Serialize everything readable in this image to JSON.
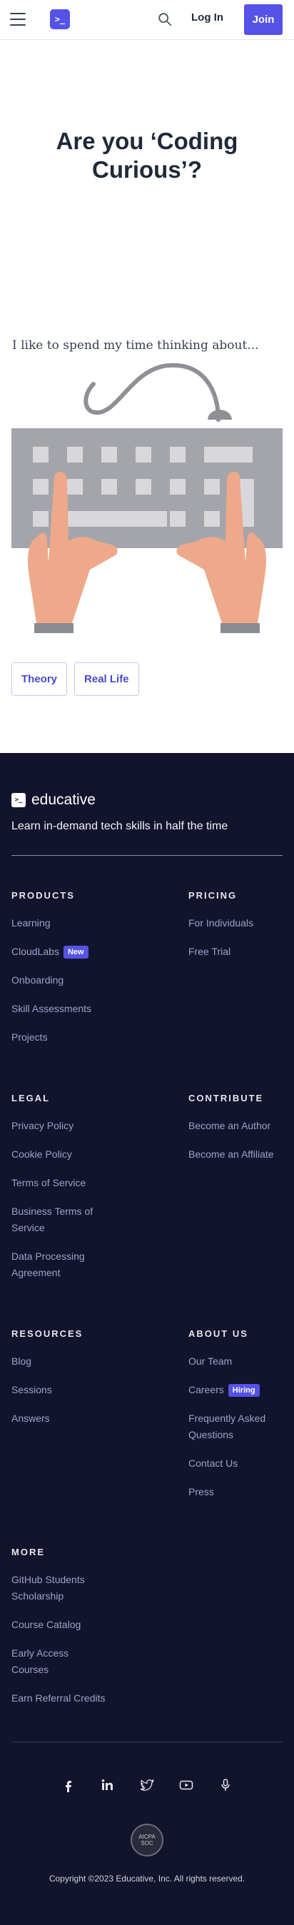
{
  "header": {
    "menu_icon": "hamburger-icon",
    "logo_glyph": ">_",
    "search_icon": "search-icon",
    "login_label": "Log In",
    "join_label": "Join",
    "accent": "#5552e8"
  },
  "hero": {
    "title": "Are you ‘Coding Curious’?",
    "question": "I like to spend my time thinking about...",
    "choices": [
      "Theory",
      "Real Life"
    ]
  },
  "footer": {
    "brand": "educative",
    "tagline": "Learn in-demand tech skills in half the time",
    "products": {
      "heading": "PRODUCTS",
      "items": [
        "Learning",
        "CloudLabs",
        "Onboarding",
        "Skill Assessments",
        "Projects"
      ],
      "badge": "New"
    },
    "pricing": {
      "heading": "PRICING",
      "items": [
        "For Individuals",
        "Free Trial"
      ]
    },
    "legal": {
      "heading": "LEGAL",
      "items": [
        "Privacy Policy",
        "Cookie Policy",
        "Terms of Service",
        "Business Terms of Service",
        "Data Processing Agreement"
      ]
    },
    "contribute": {
      "heading": "CONTRIBUTE",
      "items": [
        "Become an Author",
        "Become an Affiliate"
      ]
    },
    "resources": {
      "heading": "RESOURCES",
      "items": [
        "Blog",
        "Sessions",
        "Answers"
      ]
    },
    "about": {
      "heading": "ABOUT US",
      "items": [
        "Our Team",
        "Careers",
        "Frequently Asked Questions",
        "Contact Us",
        "Press"
      ],
      "badge": "Hiring"
    },
    "more": {
      "heading": "MORE",
      "items": [
        "GitHub Students Scholarship",
        "Course Catalog",
        "Early Access Courses",
        "Earn Referral Credits"
      ]
    },
    "social_icons": [
      "facebook-icon",
      "linkedin-icon",
      "twitter-icon",
      "youtube-icon",
      "podcast-icon"
    ],
    "seal_text": [
      "AICPA",
      "SOC"
    ],
    "copyright": "Copyright ©2023 Educative, Inc. All rights reserved."
  }
}
